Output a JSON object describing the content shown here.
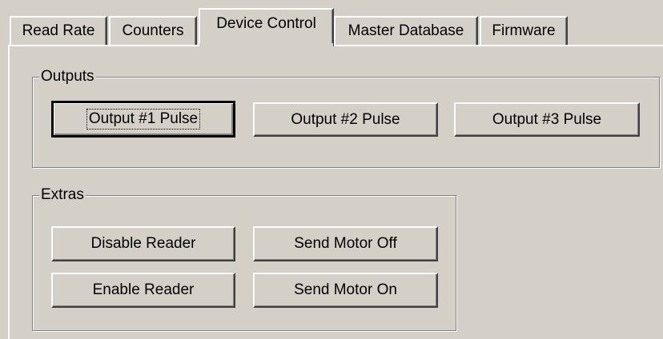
{
  "tabs": [
    {
      "label": "Read Rate"
    },
    {
      "label": "Counters"
    },
    {
      "label": "Device Control"
    },
    {
      "label": "Master Database"
    },
    {
      "label": "Firmware"
    }
  ],
  "outputs": {
    "legend": "Outputs",
    "buttons": [
      {
        "label": "Output #1 Pulse"
      },
      {
        "label": "Output #2 Pulse"
      },
      {
        "label": "Output #3 Pulse"
      }
    ]
  },
  "extras": {
    "legend": "Extras",
    "disable_reader": "Disable Reader",
    "send_motor_off": "Send Motor Off",
    "enable_reader": "Enable Reader",
    "send_motor_on": "Send Motor On"
  },
  "colors": {
    "face": "#d4d0c8",
    "highlight": "#ffffff",
    "shadow": "#808080",
    "dark_shadow": "#404040"
  }
}
